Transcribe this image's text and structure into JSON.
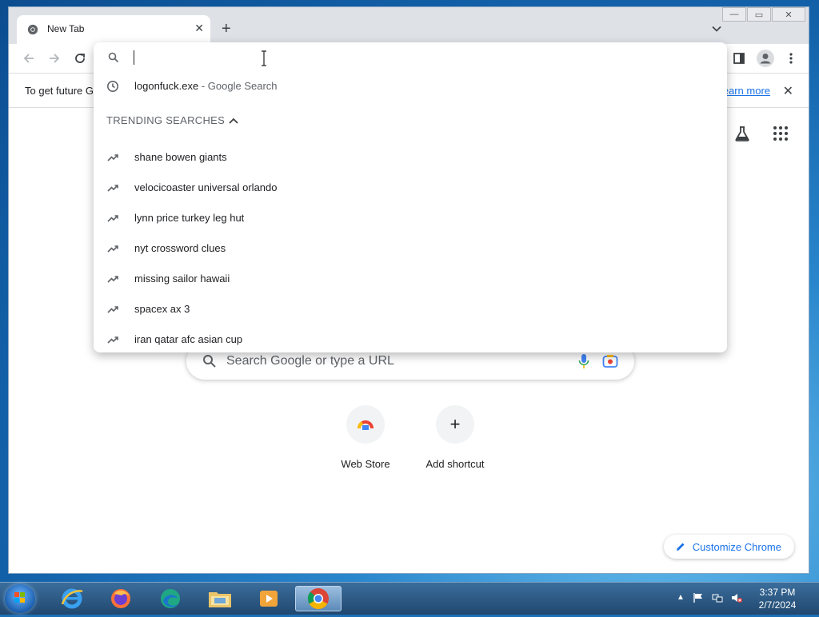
{
  "browser": {
    "tab": {
      "title": "New Tab"
    },
    "window_controls": {
      "minimize": "—",
      "maximize": "▭",
      "close": "✕"
    }
  },
  "infobar": {
    "text": "To get future G",
    "link": "earn more"
  },
  "omnibox": {
    "input_value": "",
    "history_suggestion": {
      "query": "logonfuck.exe",
      "suffix": " - Google Search"
    },
    "trending_header": "TRENDING SEARCHES",
    "trending": [
      "shane bowen giants",
      "velocicoaster universal orlando",
      "lynn price turkey leg hut",
      "nyt crossword clues",
      "missing sailor hawaii",
      "spacex ax 3",
      "iran qatar afc asian cup"
    ]
  },
  "ntp": {
    "search_placeholder": "Search Google or type a URL",
    "shortcuts": [
      {
        "label": "Web Store",
        "icon": "web-store-icon"
      },
      {
        "label": "Add shortcut",
        "icon": "plus-icon"
      }
    ],
    "customize_label": "Customize Chrome"
  },
  "taskbar": {
    "time": "3:37 PM",
    "date": "2/7/2024",
    "apps": [
      "internet-explorer-icon",
      "firefox-icon",
      "edge-icon",
      "file-explorer-icon",
      "media-player-icon",
      "chrome-icon"
    ]
  },
  "colors": {
    "accent": "#1a73e8",
    "tab_strip": "#dee1e6",
    "taskbar": "#2b5a86"
  }
}
